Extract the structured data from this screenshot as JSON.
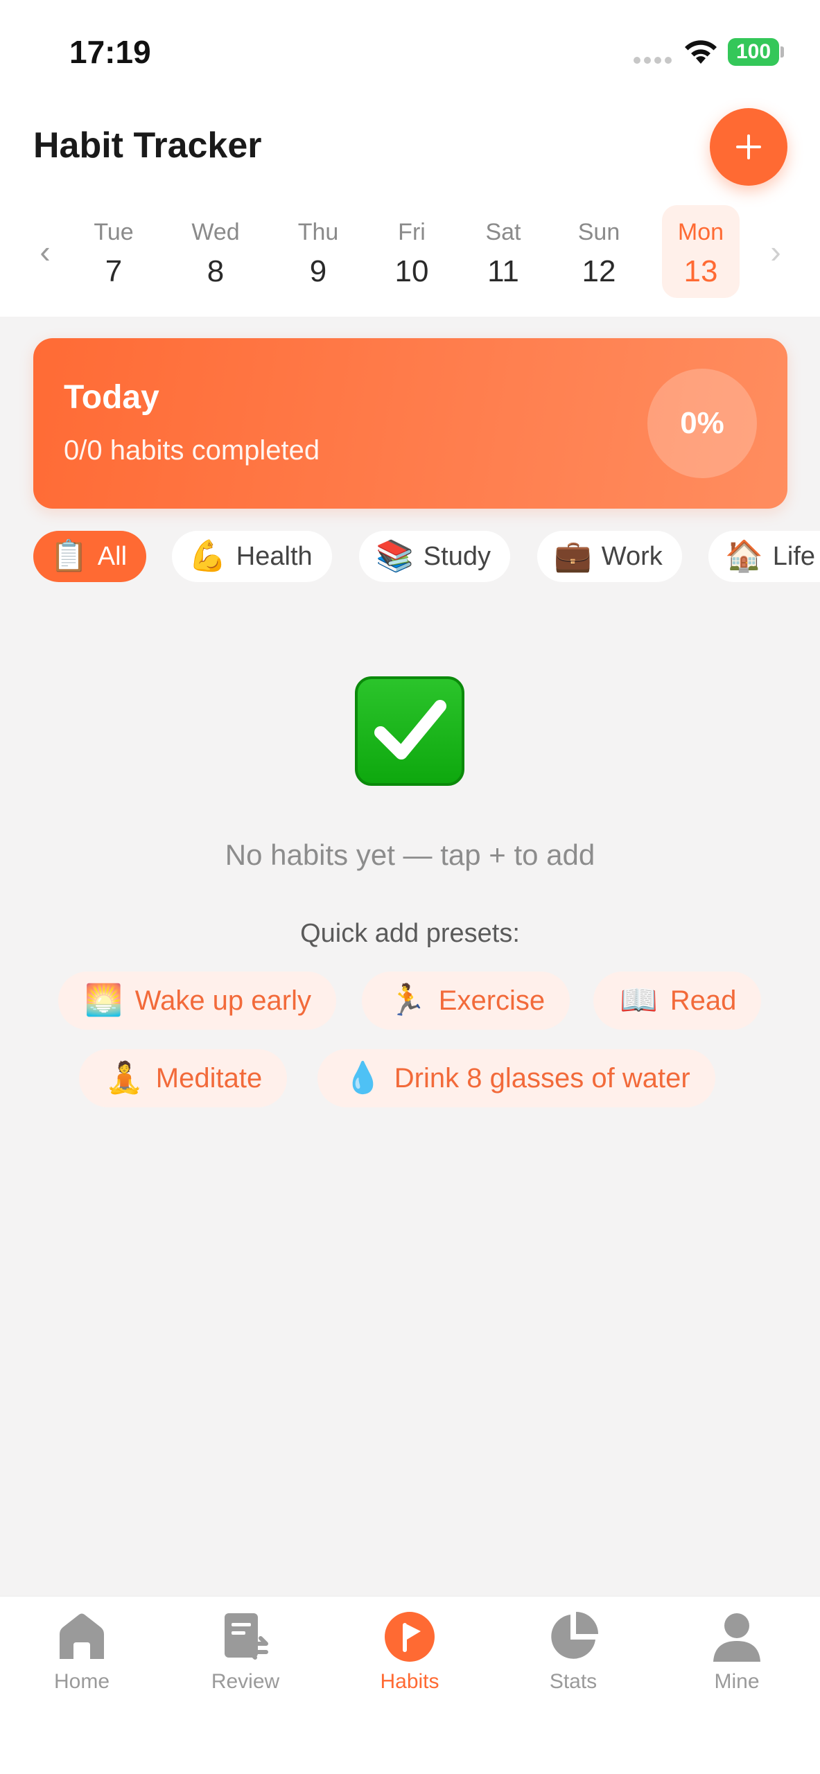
{
  "status_bar": {
    "time": "17:19",
    "battery": "100"
  },
  "header": {
    "title": "Habit Tracker",
    "add_label": "+"
  },
  "dates": [
    {
      "day": "Tue",
      "num": "7"
    },
    {
      "day": "Wed",
      "num": "8"
    },
    {
      "day": "Thu",
      "num": "9"
    },
    {
      "day": "Fri",
      "num": "10"
    },
    {
      "day": "Sat",
      "num": "11"
    },
    {
      "day": "Sun",
      "num": "12"
    },
    {
      "day": "Mon",
      "num": "13",
      "selected": true
    }
  ],
  "today": {
    "title": "Today",
    "subtitle": "0/0 habits completed",
    "percent": "0%"
  },
  "categories": [
    {
      "emoji": "📋",
      "label": "All",
      "active": true
    },
    {
      "emoji": "💪",
      "label": "Health"
    },
    {
      "emoji": "📚",
      "label": "Study"
    },
    {
      "emoji": "💼",
      "label": "Work"
    },
    {
      "emoji": "🏠",
      "label": "Life"
    }
  ],
  "empty_state": {
    "message": "No habits yet — tap + to add",
    "presets_label": "Quick add presets:"
  },
  "presets": [
    {
      "emoji": "🌅",
      "label": "Wake up early"
    },
    {
      "emoji": "🏃",
      "label": "Exercise"
    },
    {
      "emoji": "📖",
      "label": "Read"
    },
    {
      "emoji": "🧘",
      "label": "Meditate"
    },
    {
      "emoji": "💧",
      "label": "Drink 8 glasses of water"
    }
  ],
  "tabs": [
    {
      "label": "Home",
      "icon": "home-icon"
    },
    {
      "label": "Review",
      "icon": "review-icon"
    },
    {
      "label": "Habits",
      "icon": "habits-icon",
      "active": true
    },
    {
      "label": "Stats",
      "icon": "stats-icon"
    },
    {
      "label": "Mine",
      "icon": "user-icon"
    }
  ],
  "colors": {
    "accent": "#ff6a33",
    "accent_soft": "#fff0eb",
    "background": "#f4f3f3"
  }
}
